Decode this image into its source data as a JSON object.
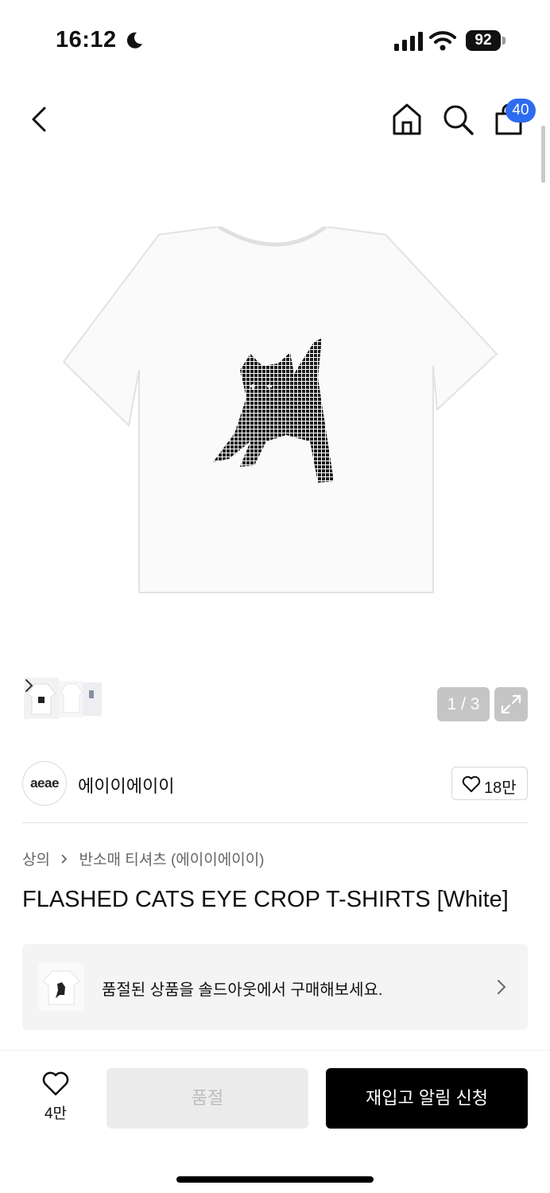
{
  "status_bar": {
    "time": "16:12",
    "battery": "92"
  },
  "header": {
    "cart_count": "40",
    "icons": [
      "back-chevron-icon",
      "home-icon",
      "search-icon",
      "shopping-bag-icon"
    ]
  },
  "gallery": {
    "pager": "1 / 3",
    "current_image": 1,
    "total_images": 3
  },
  "brand": {
    "logo_text": "aeae",
    "name": "에이이에이이",
    "likes": "18만"
  },
  "breadcrumb": {
    "category": "상의",
    "subcategory": "반소매 티셔츠 (에이이에이이)"
  },
  "product": {
    "title": "FLASHED CATS EYE CROP T-SHIRTS [White]"
  },
  "soldout_banner": {
    "text": "품절된 상품을 솔드아웃에서 구매해보세요."
  },
  "bottom_bar": {
    "wish_count": "4만",
    "soldout_label": "품절",
    "restock_label": "재입고 알림 신청"
  },
  "colors": {
    "badge": "#2d6bf0",
    "primary_button": "#000000",
    "disabled_button": "#ececed"
  }
}
